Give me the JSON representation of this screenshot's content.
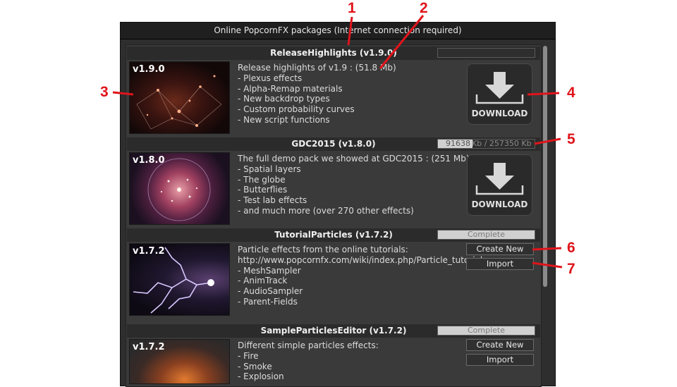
{
  "window": {
    "title": "Online PopcornFX packages (Internet connection required)"
  },
  "packages": [
    {
      "name": "ReleaseHighlights (v1.9.0)",
      "version": "v1.9.0",
      "bar": {
        "type": "empty",
        "text": ""
      },
      "description": [
        "Release highlights of v1.9 : (51.8 Mb)",
        "- Plexus effects",
        "- Alpha-Remap materials",
        "- New backdrop types",
        "- Custom probability curves",
        "- New script functions"
      ],
      "action": "DOWNLOAD"
    },
    {
      "name": "GDC2015 (v1.8.0)",
      "version": "v1.8.0",
      "bar": {
        "type": "progress",
        "downloaded": "91638",
        "rest": "Kb / 257350 Kb",
        "fraction": 0.356
      },
      "description": [
        "The full demo pack we showed at GDC2015 : (251 Mb)",
        "- Spatial layers",
        "- The globe",
        "- Butterflies",
        "- Test lab effects",
        "- and much more (over 270 other effects)"
      ],
      "action": "DOWNLOAD"
    },
    {
      "name": "TutorialParticles (v1.7.2)",
      "version": "v1.7.2",
      "bar": {
        "type": "complete",
        "text": "Complete"
      },
      "description": [
        "Particle effects from the online tutorials:",
        "http://www.popcornfx.com/wiki/index.php/Particle_tutorials",
        "- MeshSampler",
        "- AnimTrack",
        "- AudioSampler",
        "- Parent-Fields"
      ],
      "buttons": [
        "Create New",
        "Import"
      ]
    },
    {
      "name": "SampleParticlesEditor (v1.7.2)",
      "version": "v1.7.2",
      "bar": {
        "type": "complete",
        "text": "Complete"
      },
      "description": [
        "Different simple particles effects:",
        "- Fire",
        "- Smoke",
        "- Explosion"
      ],
      "buttons": [
        "Create New",
        "Import"
      ]
    }
  ],
  "callouts": [
    "1",
    "2",
    "3",
    "4",
    "5",
    "6",
    "7"
  ],
  "colors": {
    "callout": "#e0141b",
    "panel": "#3a3a3a",
    "header": "#2b2b2b"
  }
}
